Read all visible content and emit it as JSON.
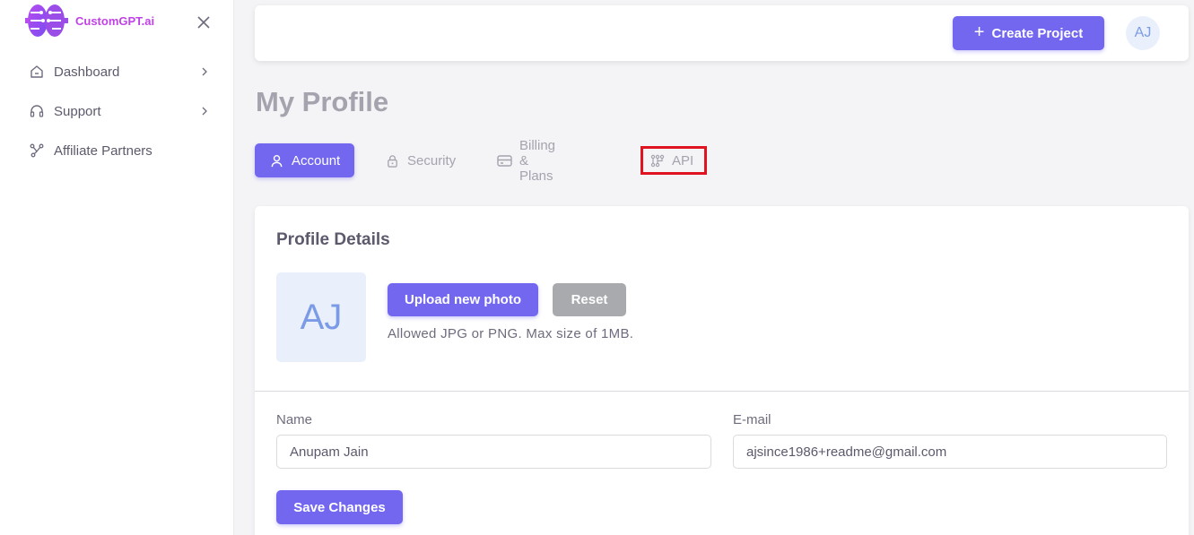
{
  "brand": {
    "name": "CustomGPT.ai",
    "logo_icon": "brain-circuit-icon"
  },
  "sidebar": {
    "close_icon": "close-icon",
    "items": [
      {
        "label": "Dashboard",
        "icon": "home-icon",
        "has_submenu": true
      },
      {
        "label": "Support",
        "icon": "headset-icon",
        "has_submenu": true
      },
      {
        "label": "Affiliate Partners",
        "icon": "network-icon",
        "has_submenu": false
      }
    ]
  },
  "header": {
    "create_button": "Create Project",
    "avatar_initials": "AJ"
  },
  "page": {
    "title": "My Profile"
  },
  "tabs": [
    {
      "label": "Account",
      "icon": "user-icon",
      "active": true
    },
    {
      "label": "Security",
      "icon": "lock-icon",
      "active": false
    },
    {
      "label": "Billing & Plans",
      "icon": "credit-card-icon",
      "active": false
    },
    {
      "label": "API",
      "icon": "api-icon",
      "active": false,
      "highlighted": true
    }
  ],
  "profile": {
    "section_title": "Profile Details",
    "avatar_initials": "AJ",
    "upload_button": "Upload new photo",
    "reset_button": "Reset",
    "hint": "Allowed JPG or PNG. Max size of 1MB.",
    "name_label": "Name",
    "name_value": "Anupam Jain",
    "email_label": "E-mail",
    "email_value": "ajsince1986+readme@gmail.com",
    "save_button": "Save Changes"
  },
  "colors": {
    "primary": "#7367f0",
    "secondary": "#a8aaae",
    "highlight_border": "#e01420",
    "brand_text": "#c042e6"
  }
}
